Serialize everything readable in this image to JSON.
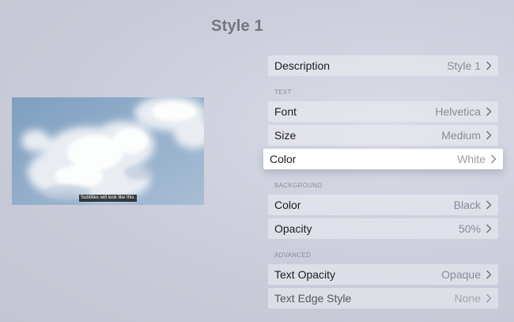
{
  "page": {
    "title": "Style 1"
  },
  "preview": {
    "subtitle_text": "Subtitles will look like this."
  },
  "description_row": {
    "label": "Description",
    "value": "Style 1"
  },
  "text_section": {
    "header": "TEXT",
    "rows": [
      {
        "label": "Font",
        "value": "Helvetica"
      },
      {
        "label": "Size",
        "value": "Medium"
      },
      {
        "label": "Color",
        "value": "White",
        "focused": true
      }
    ]
  },
  "background_section": {
    "header": "BACKGROUND",
    "rows": [
      {
        "label": "Color",
        "value": "Black"
      },
      {
        "label": "Opacity",
        "value": "50%"
      }
    ]
  },
  "advanced_section": {
    "header": "ADVANCED",
    "rows": [
      {
        "label": "Text Opacity",
        "value": "Opaque"
      },
      {
        "label": "Text Edge Style",
        "value": "None"
      }
    ]
  },
  "icons": {
    "row_disclosure": "chevron-right-icon"
  },
  "colors": {
    "focus_background": "#ffffff",
    "row_background": "#ecedf3",
    "value_text": "#8a8c95",
    "label_text": "#1d1d22"
  }
}
